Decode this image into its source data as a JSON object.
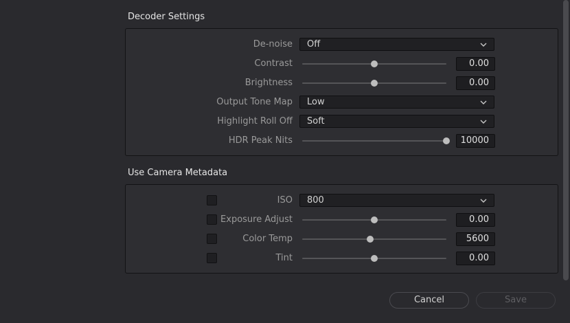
{
  "decoder": {
    "title": "Decoder Settings",
    "rows": [
      {
        "label": "De-noise",
        "type": "dropdown",
        "value": "Off"
      },
      {
        "label": "Contrast",
        "type": "slider",
        "value": "0.00",
        "level": 0.5
      },
      {
        "label": "Brightness",
        "type": "slider",
        "value": "0.00",
        "level": 0.5
      },
      {
        "label": "Output Tone Map",
        "type": "dropdown",
        "value": "Low"
      },
      {
        "label": "Highlight Roll Off",
        "type": "dropdown",
        "value": "Soft"
      },
      {
        "label": "HDR Peak Nits",
        "type": "slider",
        "value": "10000",
        "level": 1.0
      }
    ]
  },
  "camera": {
    "title": "Use Camera Metadata",
    "rows": [
      {
        "label": "ISO",
        "type": "dropdown",
        "value": "800",
        "checked": false
      },
      {
        "label": "Exposure Adjust",
        "type": "slider",
        "value": "0.00",
        "level": 0.5,
        "checked": false
      },
      {
        "label": "Color Temp",
        "type": "slider",
        "value": "5600",
        "level": 0.47,
        "checked": false
      },
      {
        "label": "Tint",
        "type": "slider",
        "value": "0.00",
        "level": 0.5,
        "checked": false
      }
    ]
  },
  "buttons": {
    "cancel": "Cancel",
    "save": "Save"
  },
  "icons": {
    "dropdown": "chevron-down-icon"
  }
}
